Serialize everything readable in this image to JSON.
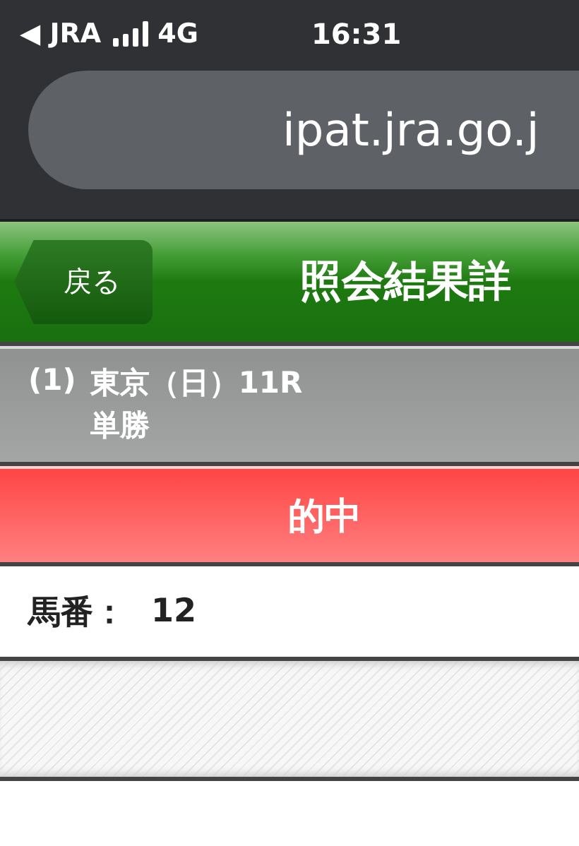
{
  "status_bar": {
    "back_label": "◀ JRA",
    "network": "4G",
    "time": "16:31"
  },
  "address_bar": {
    "url": "ipat.jra.go.j"
  },
  "nav_bar": {
    "back_button": "戻る",
    "title": "照会結果詳"
  },
  "race": {
    "number": "(1)",
    "name": "東京（日）11R",
    "bet_type": "単勝"
  },
  "result_banner": {
    "label": "的中"
  },
  "rows": [
    {
      "label": "馬番：",
      "value": "12"
    }
  ]
}
